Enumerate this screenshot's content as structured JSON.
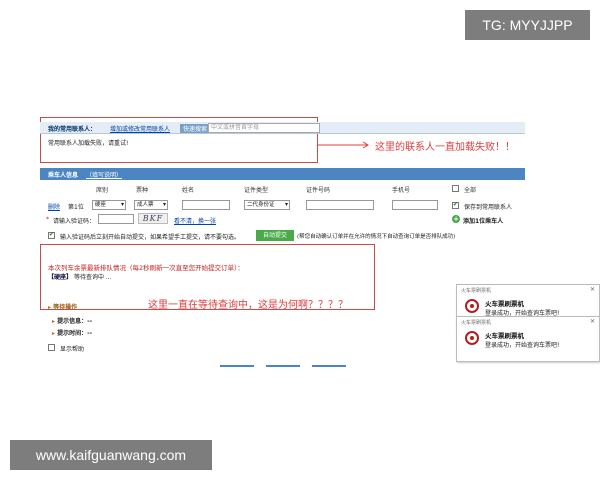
{
  "watermarks": {
    "top": "TG: MYYJJPP",
    "bottom": "www.kaifguanwang.com"
  },
  "contacts": {
    "title": "我的常用联系人：",
    "add_link": "增加或修改常用联系人",
    "quick_search_label": "快速搜索",
    "quick_search_placeholder": "中文或拼音首字母",
    "load_error": "常用联系人加载失败，请重试!"
  },
  "annotations": {
    "contacts_note": "这里的联系人一直加载失败！！",
    "queue_note": "这里一直在等待查询中，这是为何啊？？？？"
  },
  "passenger": {
    "title": "乘车人信息",
    "help_link": "（填写说明）",
    "headers": {
      "seat": "席别",
      "ticket_type": "票种",
      "name": "姓名",
      "id_type": "证件类型",
      "id_number": "证件号码",
      "phone": "手机号",
      "all": "全部"
    },
    "row": {
      "delete": "删除",
      "position": "第1位",
      "seat": "硬座",
      "ticket_type": "成人票",
      "id_type": "二代身份证",
      "save_contact": "保存到常用联系人"
    },
    "captcha_label": "请输入验证码：",
    "captcha_text": "BKF",
    "captcha_refresh": "看不清，换一张",
    "add_passenger": "添加1位乘车人",
    "auto_submit_text": "输入验证码后立刻开始自动提交，如果希望手工提交，请不要勾选。",
    "auto_submit_button": "自动提交",
    "auto_submit_note": "(帮您自动确认订单并在允许的情况下自动查询订单是否排队成功)"
  },
  "queue": {
    "title": "本次列车余票最新排队情况（每2秒刷新一次直至您开始提交订单）：",
    "ticket_tag": "【硬座】",
    "status": "等待查询中 ...",
    "wait_operation": "等待操作",
    "hint_info": "提示信息：--",
    "hint_time": "提示时间：--",
    "show_help": "显示帮助"
  },
  "popups": [
    {
      "title": "火车票刷票机",
      "heading": "火车票刷票机",
      "message": "登录成功，开始查询车票吧!"
    },
    {
      "title": "火车票刷票机",
      "heading": "火车票刷票机",
      "message": "登录成功，开始查询车票吧!"
    }
  ],
  "colors": {
    "header_blue": "#4b86c3",
    "annotation_red": "#e03c3c",
    "box_red": "#c84a4a",
    "green": "#4aaa4a"
  }
}
